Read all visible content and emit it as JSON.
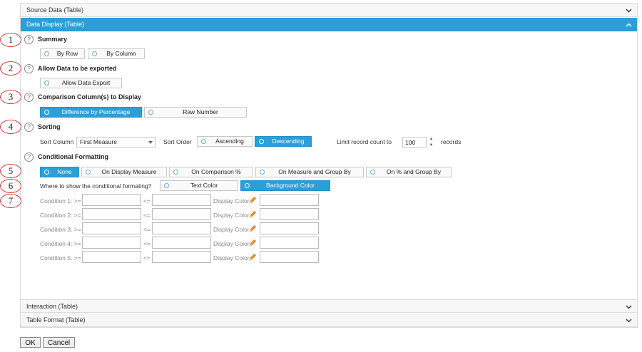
{
  "accordion": {
    "source_data": "Source Data (Table)",
    "data_display": "Data Display (Table)",
    "interaction": "Interaction (Table)",
    "table_format": "Table Format (Table)"
  },
  "markers": [
    "1",
    "2",
    "3",
    "4",
    "5",
    "6",
    "7"
  ],
  "help_glyph": "?",
  "summary": {
    "title": "Summary",
    "options": [
      "By Row",
      "By Column"
    ]
  },
  "export": {
    "title": "Allow Data to be exported",
    "option": "Allow Data Export"
  },
  "comparison": {
    "title": "Comparison Column(s) to Display",
    "options": [
      "Difference by Percentage",
      "Raw Number"
    ],
    "selected": "Difference by Percentage"
  },
  "sorting": {
    "title": "Sorting",
    "sort_column_label": "Sort Column",
    "sort_column_value": "First Measure",
    "sort_order_label": "Sort Order",
    "order_options": [
      "Ascending",
      "Descending"
    ],
    "selected": "Descending",
    "limit_label": "Limit record count to",
    "limit_value": "100",
    "records_label": "records"
  },
  "conditional": {
    "title": "Conditional Formatting",
    "options": [
      "None",
      "On Display Measure",
      "On Comparison %",
      "On Measure and Group By",
      "On % and Group By"
    ],
    "selected": "None",
    "where_label": "Where to show the conditional formating?",
    "where_options": [
      "Text Color",
      "Background Color"
    ],
    "where_selected": "Background Color",
    "conditions": [
      {
        "label": "Condition 1: >=",
        "lte": "<=",
        "color_label": "Display Color"
      },
      {
        "label": "Condition 2: >=",
        "lte": "<=",
        "color_label": "Display Color"
      },
      {
        "label": "Condition 3: >=",
        "lte": "<=",
        "color_label": "Display Color"
      },
      {
        "label": "Condition 4: >=",
        "lte": "<=",
        "color_label": "Display Color"
      },
      {
        "label": "Condition 5: >=",
        "lte": "<=",
        "color_label": "Display Color"
      }
    ]
  },
  "buttons": {
    "ok": "OK",
    "cancel": "Cancel"
  },
  "colors": {
    "accent": "#2d9fd8",
    "marker_ring": "#d23a3a"
  },
  "icons": {
    "chevron_down": "chevron-down-icon",
    "chevron_up": "chevron-up-icon",
    "help": "help-icon",
    "pencil": "pencil-icon"
  }
}
